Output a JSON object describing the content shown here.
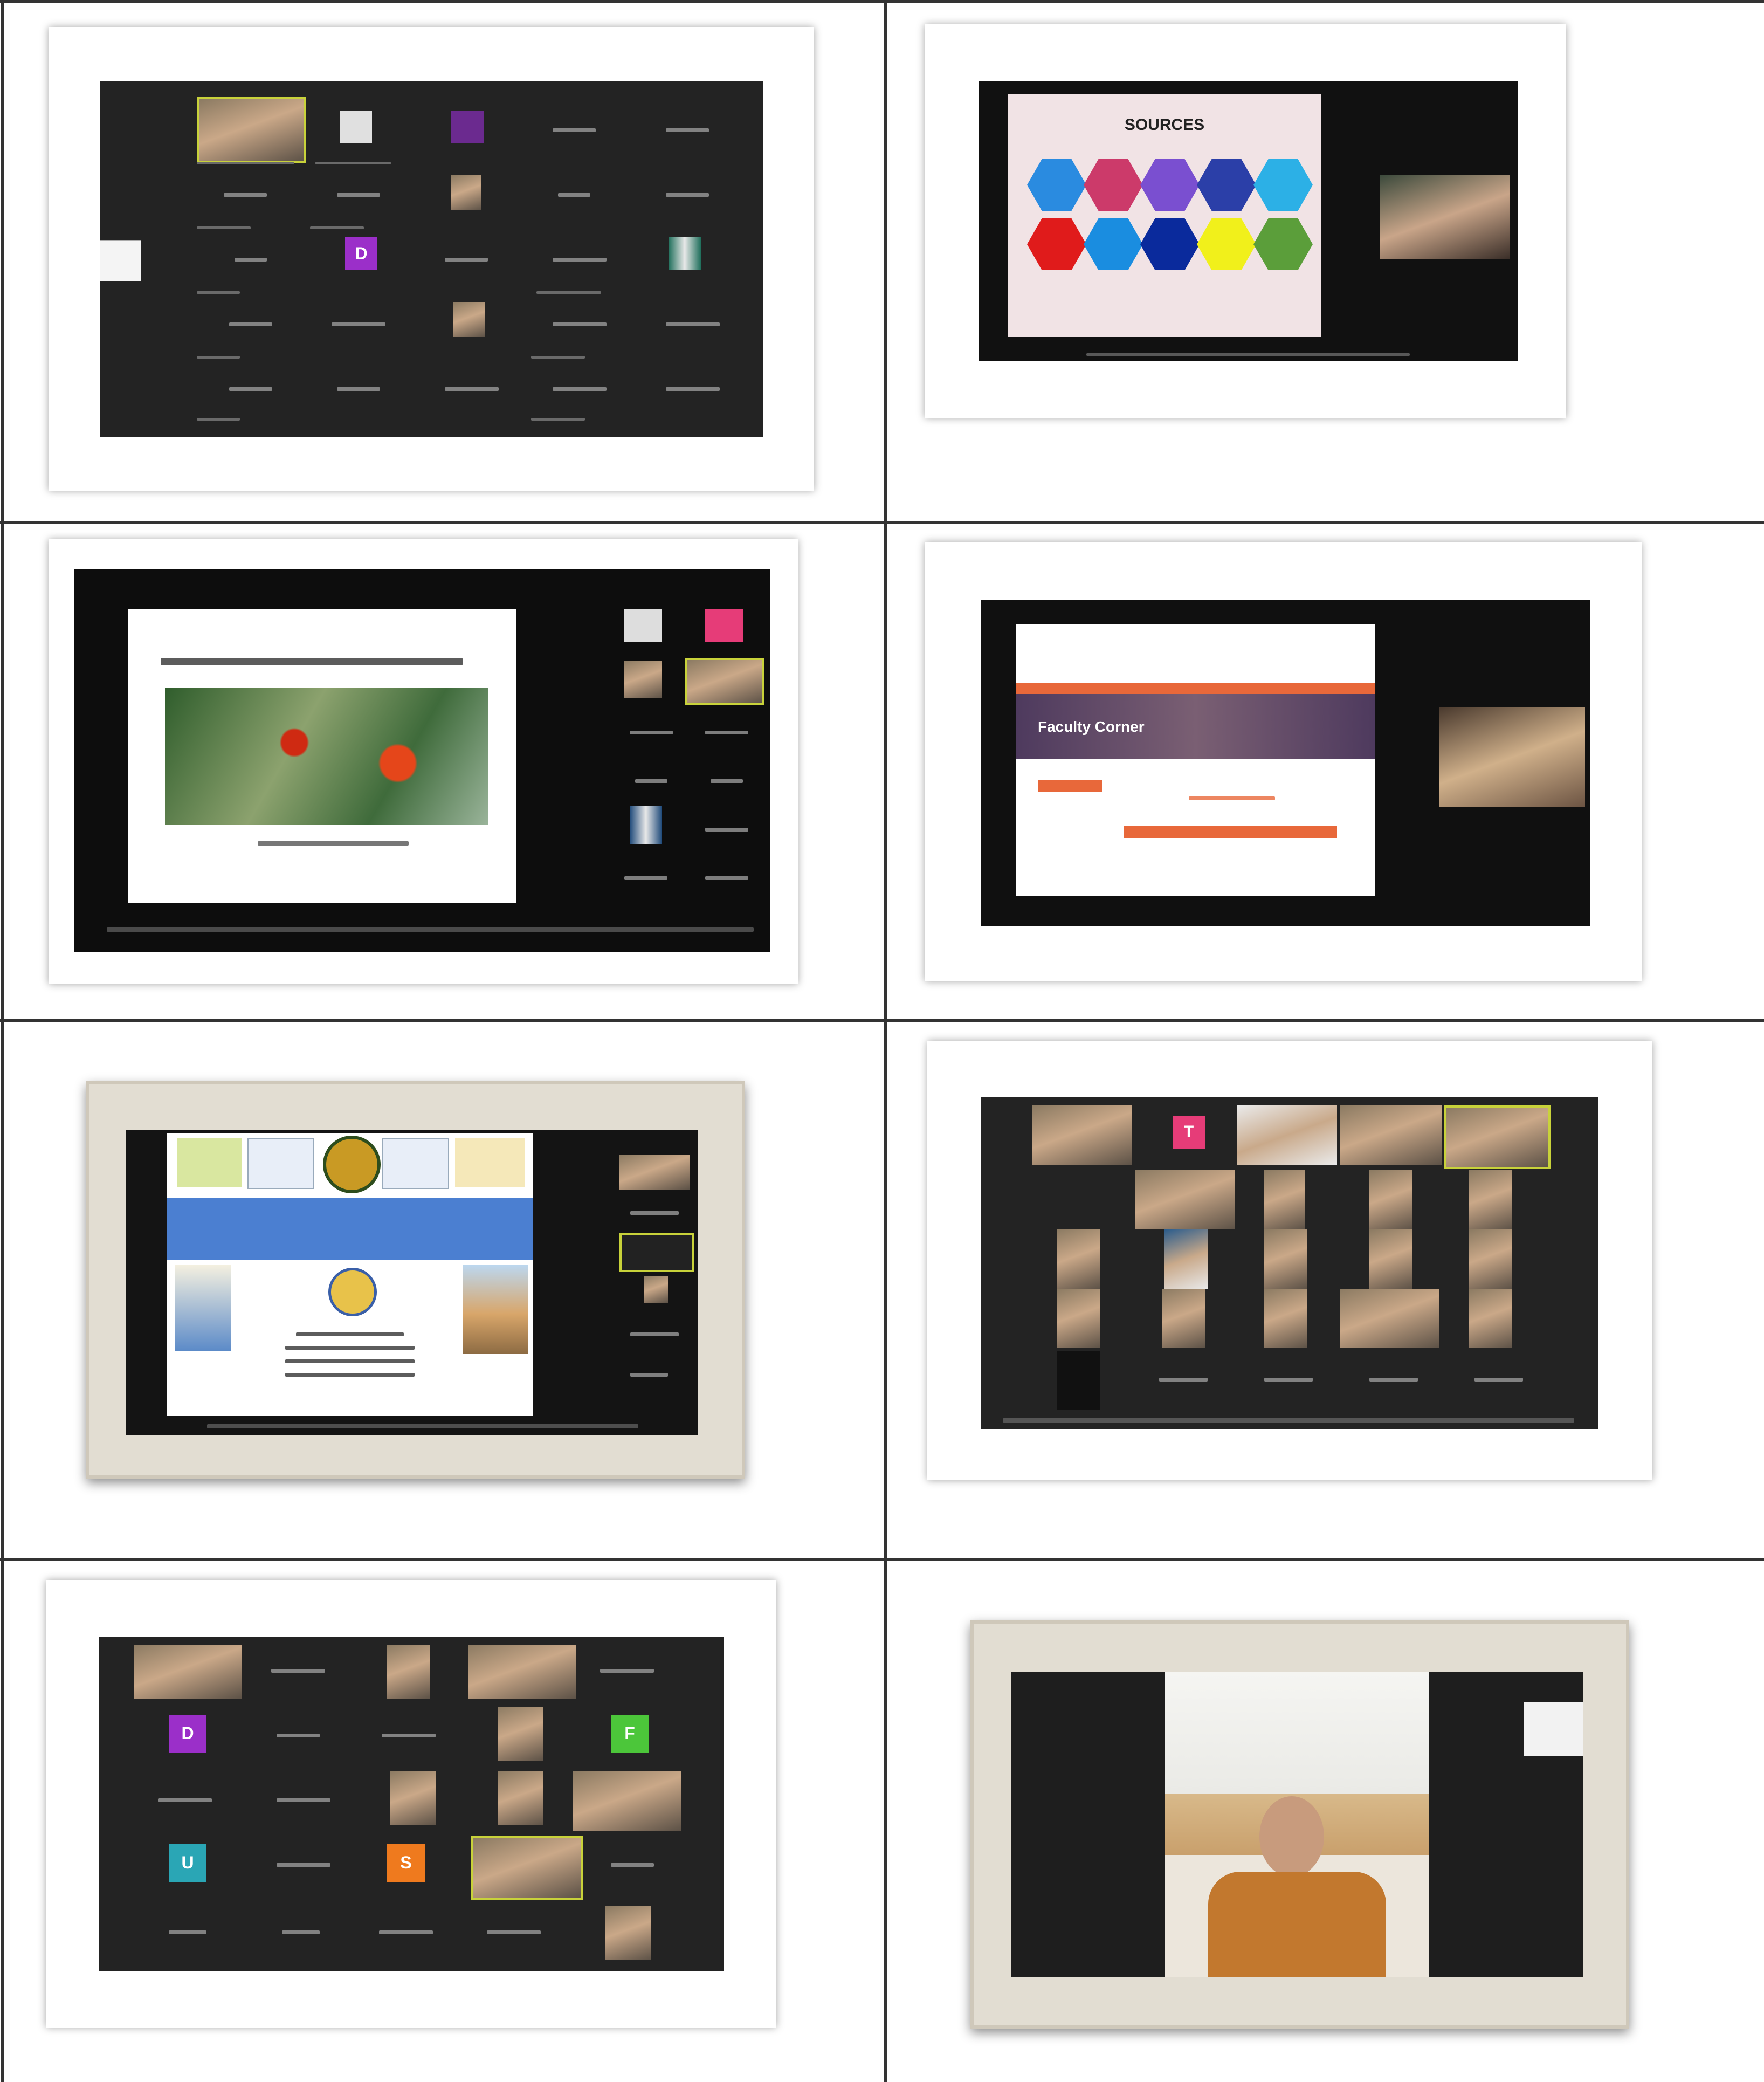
{
  "panels": {
    "p2_slide_title": "SOURCES",
    "p4_banner": "Faculty Corner",
    "p8_letter_a": "D",
    "p8_letter_b": "F",
    "p8_letter_c": "U",
    "p8_letter_d": "S",
    "p1_letter": "D",
    "p6_letter": "T"
  },
  "colors": {
    "grid_line": "#333333",
    "meeting_bg": "#232323",
    "active_speaker": "#c8d23a",
    "orange_banner": "#e8683a"
  },
  "icons": [
    "video-tile-icon",
    "participant-avatar-icon"
  ]
}
